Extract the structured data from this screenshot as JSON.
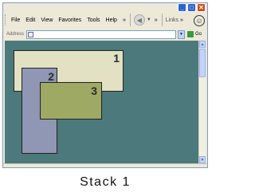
{
  "window": {
    "caption_buttons": [
      "minimize",
      "maximize",
      "close"
    ]
  },
  "menubar": {
    "items": [
      "File",
      "Edit",
      "View",
      "Favorites",
      "Tools",
      "Help"
    ],
    "chevron": "»",
    "links_label": "Links",
    "links_chevron": "»",
    "back_icon": "back-arrow-icon",
    "status_icon": "smiley-icon"
  },
  "addressbar": {
    "label": "Address",
    "value": "",
    "go_label": "Go"
  },
  "content": {
    "background": "#4c797b",
    "boxes": [
      {
        "label": "1",
        "color": "#e3e1c3"
      },
      {
        "label": "2",
        "color": "#8f97b4"
      },
      {
        "label": "3",
        "color": "#9ea964"
      }
    ]
  },
  "caption": "Stack 1"
}
